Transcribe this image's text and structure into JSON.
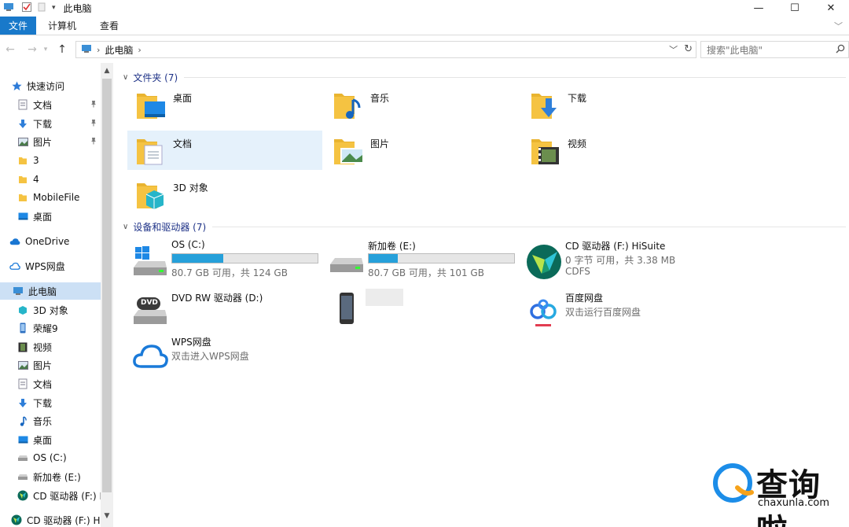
{
  "window": {
    "title": "此电脑",
    "minimize": "—",
    "maximize": "☐",
    "close": "✕"
  },
  "ribbon": {
    "tabs": [
      "文件",
      "计算机",
      "查看"
    ]
  },
  "address": {
    "root": "此电脑",
    "separator": "›"
  },
  "search": {
    "placeholder": "搜索\"此电脑\""
  },
  "sidebar": {
    "items": [
      {
        "label": "快速访问",
        "icon": "star-icon"
      },
      {
        "label": "文档",
        "icon": "document-icon",
        "pinned": true
      },
      {
        "label": "下载",
        "icon": "download-icon",
        "pinned": true
      },
      {
        "label": "图片",
        "icon": "picture-icon",
        "pinned": true
      },
      {
        "label": "3",
        "icon": "folder-icon"
      },
      {
        "label": "4",
        "icon": "folder-icon"
      },
      {
        "label": "MobileFile",
        "icon": "folder-icon"
      },
      {
        "label": "桌面",
        "icon": "desktop-icon"
      },
      {
        "label": "OneDrive",
        "icon": "cloud-icon"
      },
      {
        "label": "WPS网盘",
        "icon": "wps-cloud-icon"
      },
      {
        "label": "此电脑",
        "icon": "computer-icon"
      },
      {
        "label": "3D 对象",
        "icon": "cube-icon"
      },
      {
        "label": "荣耀9",
        "icon": "phone-icon"
      },
      {
        "label": "视频",
        "icon": "video-icon"
      },
      {
        "label": "图片",
        "icon": "picture-icon"
      },
      {
        "label": "文档",
        "icon": "document-icon"
      },
      {
        "label": "下载",
        "icon": "download-icon"
      },
      {
        "label": "音乐",
        "icon": "music-icon"
      },
      {
        "label": "桌面",
        "icon": "desktop-icon"
      },
      {
        "label": "OS (C:)",
        "icon": "drive-icon"
      },
      {
        "label": "新加卷 (E:)",
        "icon": "drive-icon"
      },
      {
        "label": "CD 驱动器 (F:) H",
        "icon": "hisuite-icon"
      },
      {
        "label": "CD 驱动器 (F:) Hi",
        "icon": "hisuite-icon"
      }
    ]
  },
  "folders": {
    "header": "文件夹 (7)",
    "items": [
      {
        "name": "桌面"
      },
      {
        "name": "音乐"
      },
      {
        "name": "下载"
      },
      {
        "name": "文档"
      },
      {
        "name": "图片"
      },
      {
        "name": "视频"
      },
      {
        "name": "3D 对象"
      }
    ]
  },
  "devices": {
    "header": "设备和驱动器 (7)",
    "os_c": {
      "name": "OS (C:)",
      "used_fraction": 0.35,
      "info": "80.7 GB 可用，共 124 GB"
    },
    "vol_e": {
      "name": "新加卷 (E:)",
      "used_fraction": 0.2,
      "info": "80.7 GB 可用，共 101 GB"
    },
    "cd_f": {
      "name": "CD 驱动器 (F:) HiSuite",
      "info": "0 字节 可用，共 3.38 MB",
      "fs": "CDFS"
    },
    "dvd_d": {
      "name": "DVD RW 驱动器 (D:)",
      "badge": "DVD"
    },
    "baidu": {
      "name": "百度网盘",
      "info": "双击运行百度网盘"
    },
    "wps": {
      "name": "WPS网盘",
      "info": "双击进入WPS网盘"
    }
  },
  "watermark": {
    "text": "查询啦",
    "url": "chaxunla.com"
  },
  "colors": {
    "accent": "#1979ca",
    "folder": "#f5c342",
    "bar_fill": "#26a0da",
    "selection": "#cce0f5"
  }
}
